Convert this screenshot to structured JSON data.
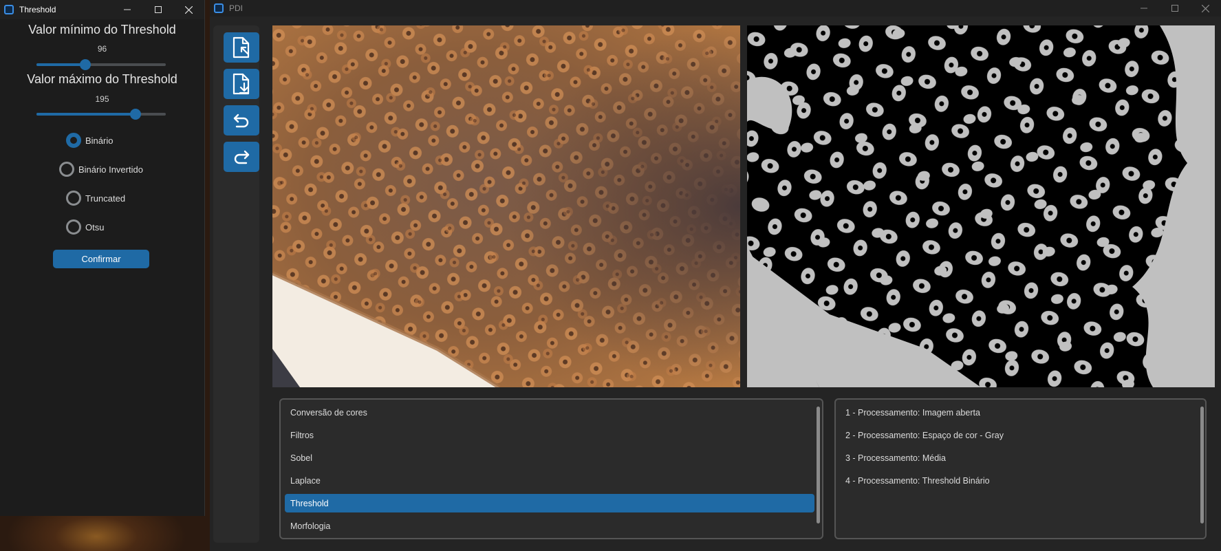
{
  "threshold_dialog": {
    "title": "Threshold",
    "min_label": "Valor mínimo do Threshold",
    "min_value": "96",
    "min_fraction": 0.376,
    "max_label": "Valor máximo do Threshold",
    "max_value": "195",
    "max_fraction": 0.765,
    "radio_options": [
      {
        "label": "Binário",
        "checked": true
      },
      {
        "label": "Binário Invertido",
        "checked": false
      },
      {
        "label": "Truncated",
        "checked": false
      },
      {
        "label": "Otsu",
        "checked": false
      }
    ],
    "confirm_label": "Confirmar"
  },
  "main_window": {
    "title": "PDI",
    "toolbar": [
      {
        "icon": "open-file-icon"
      },
      {
        "icon": "save-file-icon"
      },
      {
        "icon": "undo-icon"
      },
      {
        "icon": "redo-icon"
      }
    ],
    "operations": [
      {
        "label": "Conversão de cores",
        "selected": false
      },
      {
        "label": "Filtros",
        "selected": false
      },
      {
        "label": "Sobel",
        "selected": false
      },
      {
        "label": "Laplace",
        "selected": false
      },
      {
        "label": "Threshold",
        "selected": true
      },
      {
        "label": "Morfologia",
        "selected": false
      }
    ],
    "history": [
      "1 - Processamento: Imagem aberta",
      "2 - Processamento: Espaço de cor - Gray",
      "3 - Processamento: Média",
      "4 - Processamento: Threshold Binário"
    ]
  },
  "colors": {
    "accent": "#1f6aa5",
    "dialog_bg": "#1c1c1c",
    "main_bg": "#242424",
    "threshold_fg": "#c0c0c0",
    "threshold_bg": "#000000"
  }
}
